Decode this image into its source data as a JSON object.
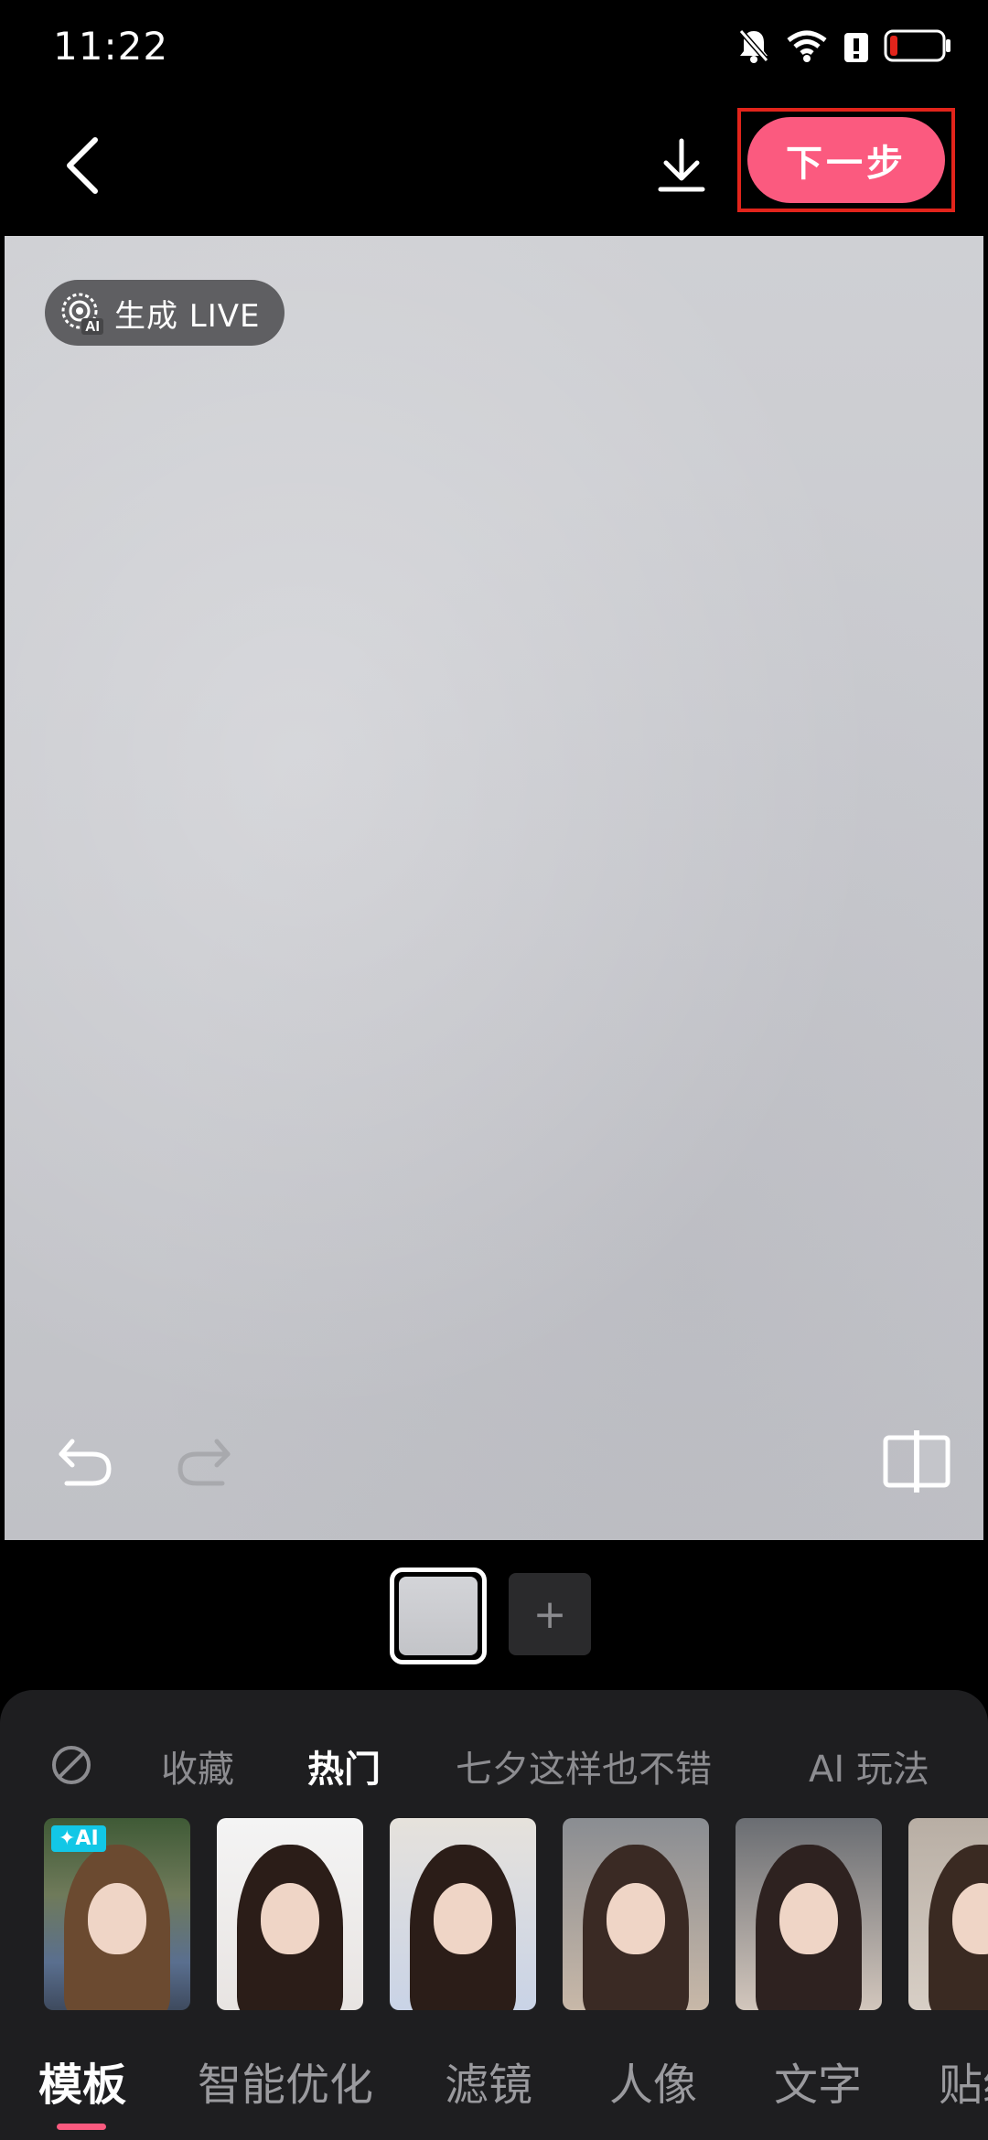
{
  "status_bar": {
    "time": "11:22",
    "icons": [
      "bell-muted-icon",
      "wifi-icon",
      "alert-icon",
      "battery-low-icon"
    ]
  },
  "topbar": {
    "back_icon": "chevron-left-icon",
    "download_icon": "download-icon",
    "next_label": "下一步",
    "next_color": "#fb5a7f",
    "highlight_color": "#e2241b"
  },
  "canvas": {
    "live_badge": {
      "icon": "ai-live-icon",
      "label": "生成 LIVE"
    },
    "undo_icon": "undo-icon",
    "redo_icon": "redo-icon",
    "compare_icon": "compare-icon"
  },
  "thumbnails": {
    "add_label": "+"
  },
  "categories": {
    "none_icon": "no-effect-icon",
    "items": [
      {
        "label": "收藏",
        "active": false
      },
      {
        "label": "热门",
        "active": true
      },
      {
        "label": "七夕这样也不错",
        "active": false
      },
      {
        "label": "AI 玩法",
        "active": false
      }
    ]
  },
  "templates": {
    "ai_tag": "✦AI",
    "count": 6
  },
  "tabs": {
    "items": [
      {
        "label": "模板",
        "active": true
      },
      {
        "label": "智能优化",
        "active": false
      },
      {
        "label": "滤镜",
        "active": false
      },
      {
        "label": "人像",
        "active": false
      },
      {
        "label": "文字",
        "active": false
      },
      {
        "label": "贴纸",
        "active": false
      }
    ],
    "indicator_color": "#fb5a7f"
  }
}
